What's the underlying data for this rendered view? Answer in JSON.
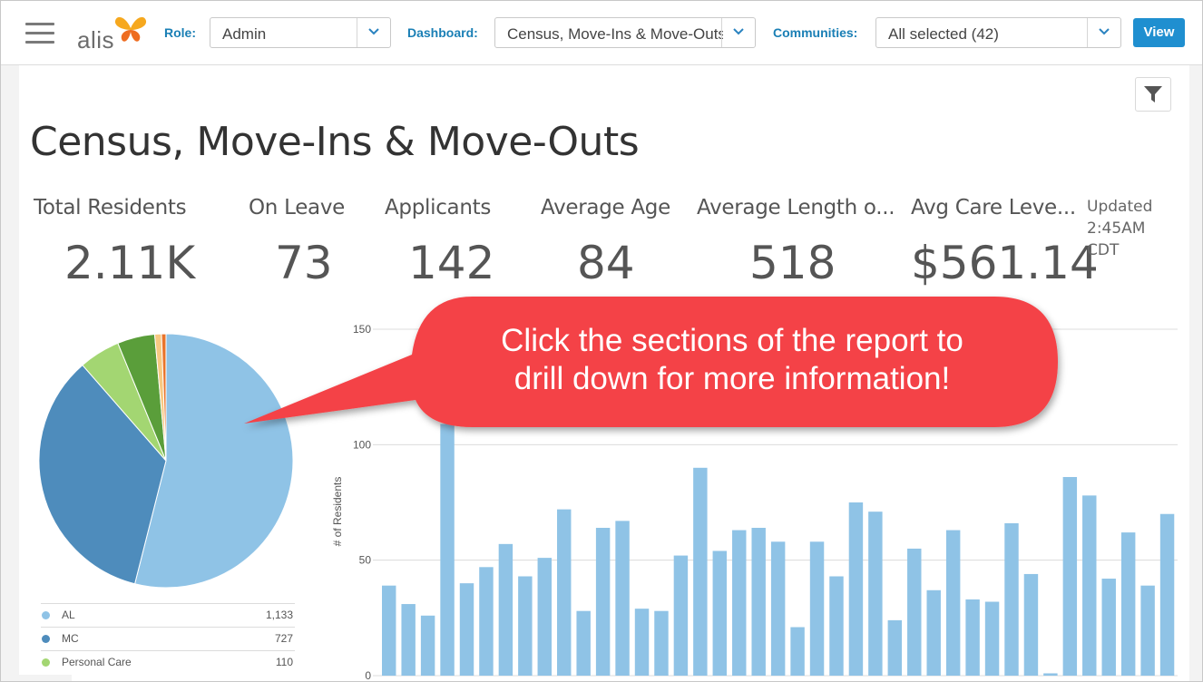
{
  "app": {
    "logo_text": "alis"
  },
  "header": {
    "role_label": "Role:",
    "role_value": "Admin",
    "dashboard_label": "Dashboard:",
    "dashboard_value": "Census, Move-Ins & Move-Outs",
    "communities_label": "Communities:",
    "communities_value": "All selected (42)",
    "view_label": "View"
  },
  "page": {
    "title": "Census, Move-Ins & Move-Outs"
  },
  "kpis": [
    {
      "label": "Total Residents",
      "value": "2.11K"
    },
    {
      "label": "On Leave",
      "value": "73"
    },
    {
      "label": "Applicants",
      "value": "142"
    },
    {
      "label": "Average Age",
      "value": "84"
    },
    {
      "label": "Average Length o...",
      "value": "518"
    },
    {
      "label": "Avg Care Leve...",
      "value": "$561.14"
    }
  ],
  "updated": {
    "line1": "Updated",
    "line2": "2:45AM",
    "line3": "CDT"
  },
  "callout": {
    "line1": "Click the sections of the report to",
    "line2": "drill down for more information!"
  },
  "colors": {
    "accent": "#1f8fd0",
    "label_blue": "#1a7fb5",
    "callout": "#f44346",
    "bar": "#8fc3e6"
  },
  "legend": [
    {
      "name": "AL",
      "value": "1,133",
      "color": "#8fc3e6"
    },
    {
      "name": "MC",
      "value": "727",
      "color": "#4e8cbc"
    },
    {
      "name": "Personal Care",
      "value": "110",
      "color": "#a3d672"
    }
  ],
  "chart_data": [
    {
      "type": "pie",
      "slices": [
        {
          "label": "AL",
          "value": 1133,
          "color": "#8fc3e6"
        },
        {
          "label": "MC",
          "value": 727,
          "color": "#4e8cbc"
        },
        {
          "label": "Personal Care",
          "value": 110,
          "color": "#a3d672"
        },
        {
          "label": "",
          "value": 100,
          "color": "#5a9e3a"
        },
        {
          "label": "",
          "value": 18,
          "color": "#f7c982"
        },
        {
          "label": "",
          "value": 12,
          "color": "#e9742b"
        }
      ]
    },
    {
      "type": "bar",
      "ylabel": "# of Residents",
      "ylim": [
        0,
        150
      ],
      "yticks": [
        0,
        50,
        100,
        150
      ],
      "values": [
        39,
        31,
        26,
        109,
        40,
        47,
        57,
        43,
        51,
        72,
        28,
        64,
        67,
        29,
        28,
        52,
        90,
        54,
        63,
        64,
        58,
        21,
        58,
        43,
        75,
        71,
        24,
        55,
        37,
        63,
        33,
        32,
        66,
        44,
        1,
        86,
        78,
        42,
        62,
        39,
        70
      ]
    }
  ]
}
